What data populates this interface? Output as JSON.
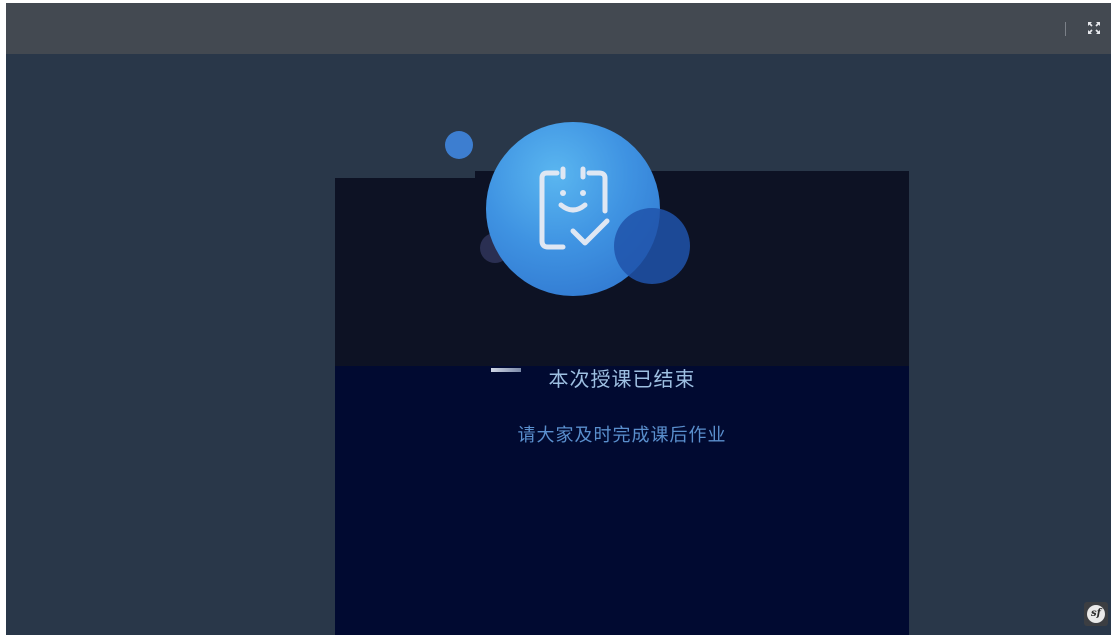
{
  "header": {
    "fullscreen_icon": "expand-fullscreen-icon"
  },
  "main": {
    "illustration_icon": "clipboard-smile-check-icon",
    "title": "本次授课已结束",
    "subtitle": "请大家及时完成课后作业"
  },
  "footer": {
    "logo_text": "sf"
  },
  "colors": {
    "background": "#293749",
    "topbar": "#434951",
    "panel_top": "#0d1224",
    "panel_bottom": "#010a31",
    "accent_blue": "#3f93e2",
    "title_text": "#9ec0e2",
    "subtitle_text": "#5a8fcd"
  }
}
